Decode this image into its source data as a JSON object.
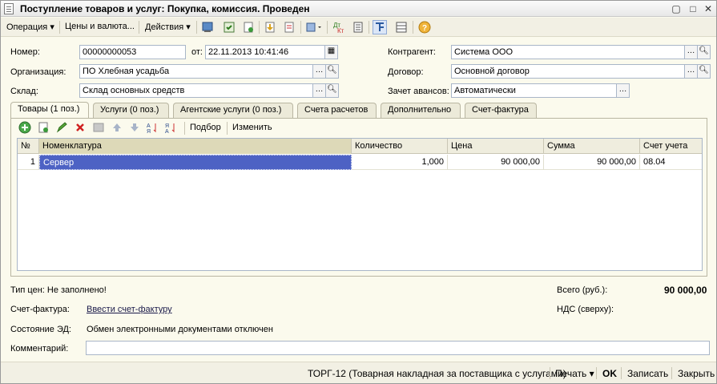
{
  "window": {
    "title": "Поступление товаров и услуг: Покупка, комиссия. Проведен"
  },
  "toolbar": {
    "operation": "Операция",
    "prices": "Цены и валюта...",
    "actions": "Действия"
  },
  "form": {
    "number_label": "Номер:",
    "number_value": "00000000053",
    "from_label": "от:",
    "date_value": "22.11.2013 10:41:46",
    "org_label": "Организация:",
    "org_value": "ПО Хлебная усадьба",
    "warehouse_label": "Склад:",
    "warehouse_value": "Склад основных средств",
    "counterparty_label": "Контрагент:",
    "counterparty_value": "Система ООО",
    "contract_label": "Договор:",
    "contract_value": "Основной договор",
    "advances_label": "Зачет авансов:",
    "advances_value": "Автоматически"
  },
  "tabs": [
    {
      "label": "Товары (1 поз.)"
    },
    {
      "label": "Услуги (0 поз.)"
    },
    {
      "label": "Агентские услуги (0 поз.)"
    },
    {
      "label": "Счета расчетов"
    },
    {
      "label": "Дополнительно"
    },
    {
      "label": "Счет-фактура"
    }
  ],
  "panel_toolbar": {
    "pick": "Подбор",
    "edit": "Изменить"
  },
  "grid": {
    "columns": [
      "№",
      "Номенклатура",
      "Количество",
      "Цена",
      "Сумма",
      "Счет учета"
    ],
    "rows": [
      {
        "n": "1",
        "item": "Сервер",
        "qty": "1,000",
        "price": "90 000,00",
        "sum": "90 000,00",
        "account": "08.04"
      }
    ]
  },
  "footer": {
    "price_type": "Тип цен: Не заполнено!",
    "total_label": "Всего (руб.):",
    "total_value": "90 000,00",
    "invoice_label": "Счет-фактура:",
    "invoice_link": "Ввести счет-фактуру",
    "vat_label": "НДС (сверху):",
    "ed_label": "Состояние ЭД:",
    "ed_value": "Обмен электронными документами отключен",
    "comment_label": "Комментарий:"
  },
  "statusbar": {
    "torg": "ТОРГ-12 (Товарная накладная за поставщика с услугами)",
    "print": "Печать",
    "ok": "OK",
    "save": "Записать",
    "close": "Закрыть"
  }
}
